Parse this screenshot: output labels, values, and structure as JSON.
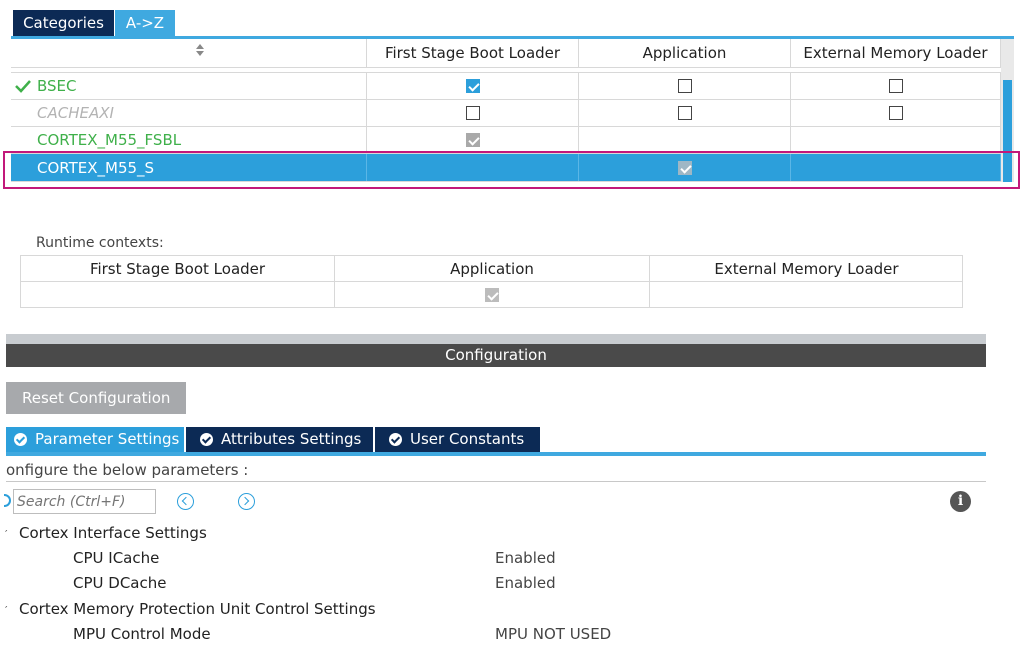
{
  "top_tabs": {
    "categories": "Categories",
    "az": "A->Z"
  },
  "grid": {
    "headers": [
      "",
      "First Stage Boot Loader",
      "Application",
      "External Memory Loader"
    ],
    "rows": [
      {
        "name": "BSEC",
        "state": "checked-green",
        "fsbl": "checked",
        "app": "unchecked",
        "ext": "unchecked"
      },
      {
        "name": "CACHEAXI",
        "state": "disabled",
        "fsbl": "unchecked",
        "app": "unchecked",
        "ext": "unchecked"
      },
      {
        "name": "CORTEX_M55_FSBL",
        "state": "normal",
        "fsbl": "checked-disabled",
        "app": "none",
        "ext": "none"
      },
      {
        "name": "CORTEX_M55_S",
        "state": "selected",
        "fsbl": "none",
        "app": "checked-disabled",
        "ext": "none"
      }
    ]
  },
  "runtime": {
    "label": "Runtime contexts:",
    "headers": [
      "First Stage Boot Loader",
      "Application",
      "External Memory Loader"
    ],
    "values": [
      "none",
      "checked-disabled",
      "none"
    ]
  },
  "configuration": {
    "title": "Configuration",
    "reset_label": "Reset Configuration",
    "tabs": [
      "Parameter Settings",
      "Attributes Settings",
      "User Constants"
    ],
    "description": "onfigure the below parameters :",
    "search_placeholder": "Search (Ctrl+F)",
    "groups": [
      {
        "name": "Cortex Interface Settings",
        "params": [
          {
            "name": "CPU ICache",
            "value": "Enabled"
          },
          {
            "name": "CPU DCache",
            "value": "Enabled"
          }
        ]
      },
      {
        "name": "Cortex Memory Protection Unit Control Settings",
        "params": [
          {
            "name": "MPU Control Mode",
            "value": "MPU NOT USED"
          }
        ]
      }
    ]
  },
  "colors": {
    "accent": "#2c9fdb",
    "navy": "#0c2a55",
    "green": "#3fb04a",
    "highlight": "#c2187a"
  },
  "icons": {
    "check": "check-icon",
    "sort": "sort-icon",
    "info": "info-icon",
    "prev": "chevron-left-icon",
    "next": "chevron-right-icon"
  }
}
